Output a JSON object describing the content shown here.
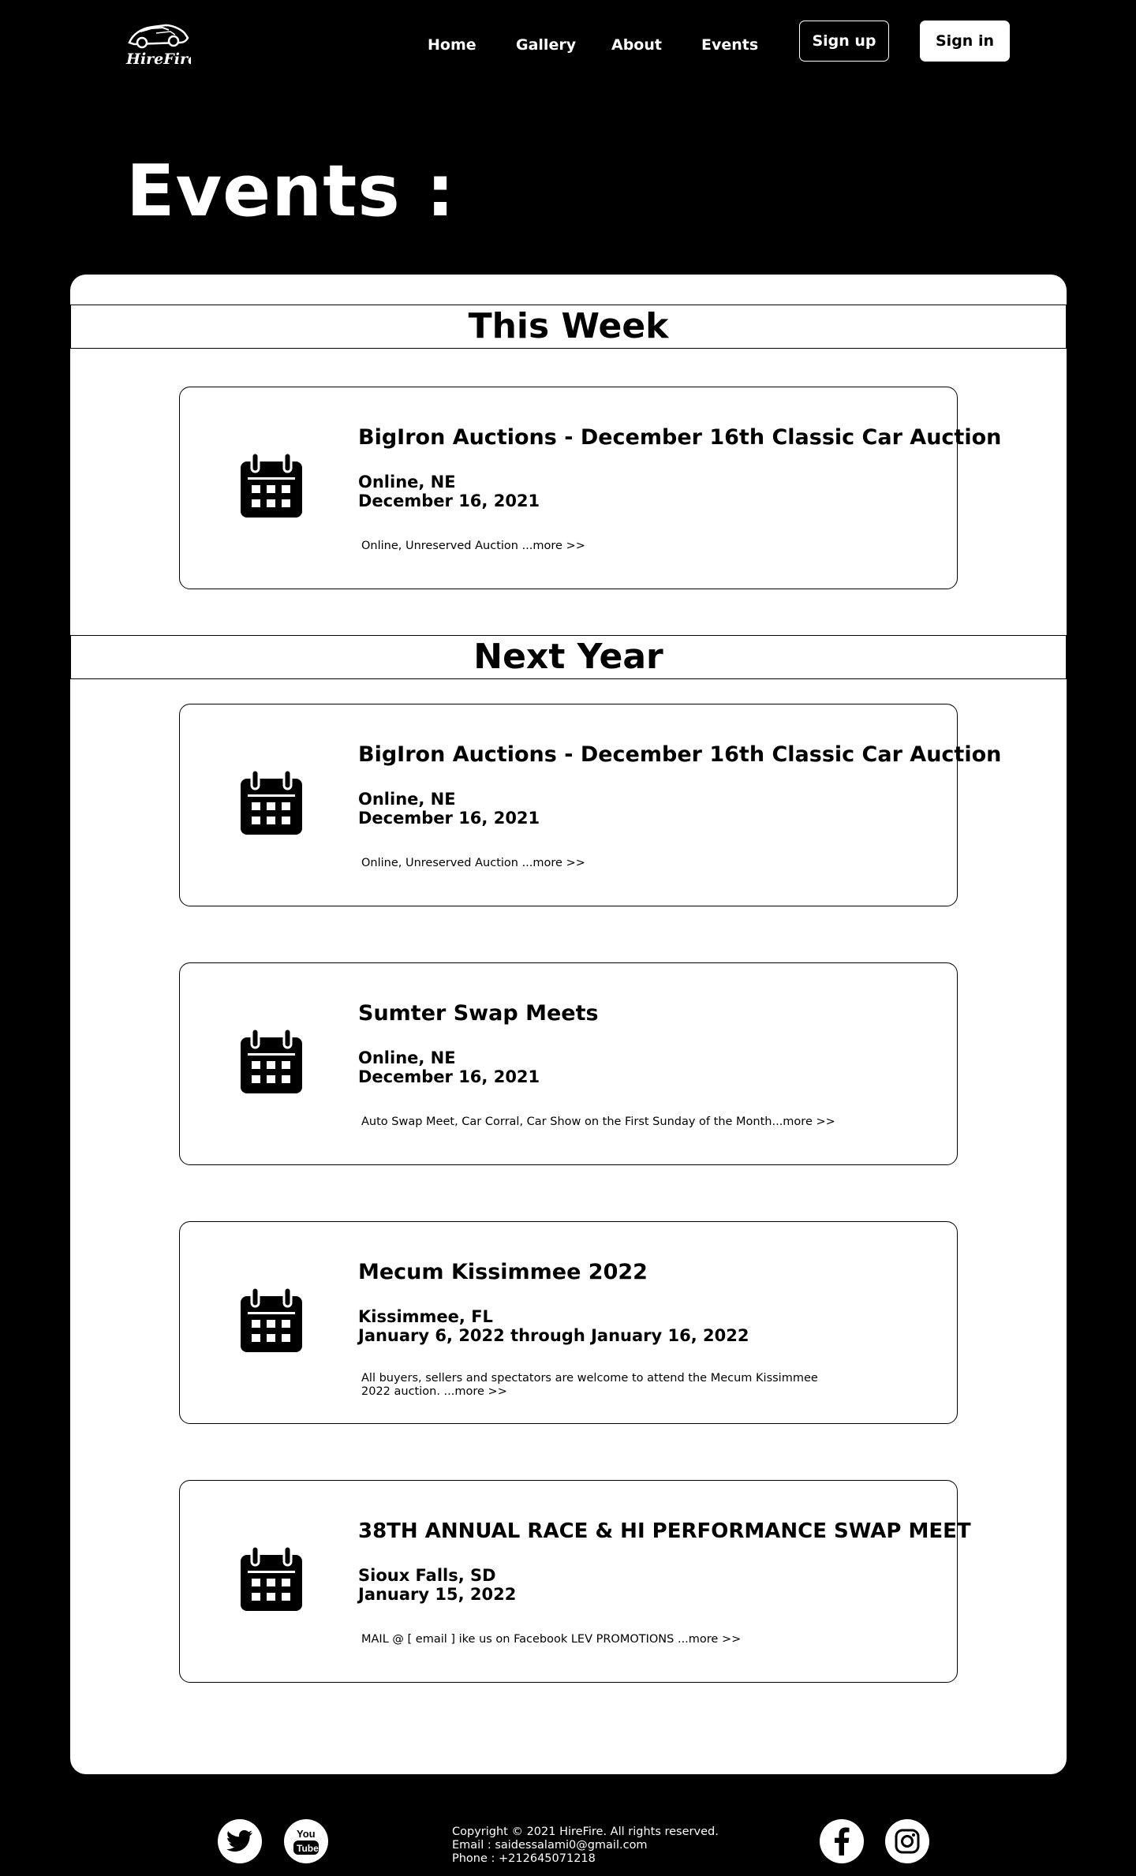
{
  "brand": {
    "logo_text": "HireFire"
  },
  "nav": {
    "items": [
      {
        "label": "Home"
      },
      {
        "label": "Gallery"
      },
      {
        "label": "About"
      },
      {
        "label": "Events"
      }
    ],
    "signup_label": "Sign up",
    "signin_label": "Sign in"
  },
  "page": {
    "title": "Events :"
  },
  "sections": [
    {
      "heading": "This Week"
    },
    {
      "heading": "Next Year"
    }
  ],
  "events": [
    {
      "title": "BigIron Auctions - December 16th Classic Car Auction",
      "location": "Online, NE",
      "date": "December 16, 2021",
      "description": "Online, Unreserved Auction ...more >>"
    },
    {
      "title": "BigIron Auctions - December 16th Classic Car Auction",
      "location": "Online, NE",
      "date": "December 16, 2021",
      "description": "Online, Unreserved Auction ...more >>"
    },
    {
      "title": "Sumter Swap Meets",
      "location": "Online, NE",
      "date": "December 16, 2021",
      "description": "Auto Swap Meet, Car Corral, Car Show on the First Sunday of the Month...more >>"
    },
    {
      "title": "Mecum Kissimmee 2022",
      "location": "Kissimmee, FL",
      "date": "January 6, 2022 through January 16, 2022",
      "description": "All buyers, sellers and spectators are welcome to attend the Mecum Kissimmee 2022 auction. ...more >>"
    },
    {
      "title": "38TH ANNUAL RACE & HI PERFORMANCE SWAP MEET",
      "location": "Sioux Falls, SD",
      "date": "January 15, 2022",
      "description": "MAIL @ [ email ] ike us on Facebook LEV PROMOTIONS ...more >>"
    }
  ],
  "footer": {
    "copyright": "Copyright © 2021 HireFire. All rights reserved.",
    "email": "Email : saidessalami0@gmail.com",
    "phone": "Phone : +212645071218",
    "social_icons": [
      "twitter-icon",
      "youtube-icon",
      "facebook-icon",
      "instagram-icon"
    ]
  },
  "colors": {
    "background": "#000000",
    "panel": "#ffffff",
    "text_dark": "#000000",
    "text_light": "#ffffff"
  }
}
